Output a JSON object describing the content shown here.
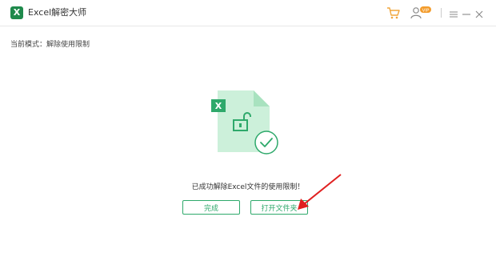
{
  "app": {
    "logo_letter": "X",
    "title": "Excel解密大师",
    "badge": "VIP"
  },
  "mode": {
    "label": "当前模式：",
    "value": "解除使用限制"
  },
  "illustration": {
    "file_badge": "X"
  },
  "result": {
    "message": "已成功解除Excel文件的使用限制！"
  },
  "buttons": {
    "done": "完成",
    "open_folder": "打开文件夹"
  },
  "colors": {
    "accent": "#2ea96b",
    "file_bg": "#ccf0da",
    "file_fold": "#a8e2bf",
    "annotation": "#e02020"
  },
  "icons": {
    "cart": "cart-icon",
    "user": "user-icon",
    "menu": "menu-icon",
    "minimize": "minimize-icon",
    "close": "close-icon",
    "unlock": "unlock-icon",
    "check": "check-circle-icon"
  }
}
